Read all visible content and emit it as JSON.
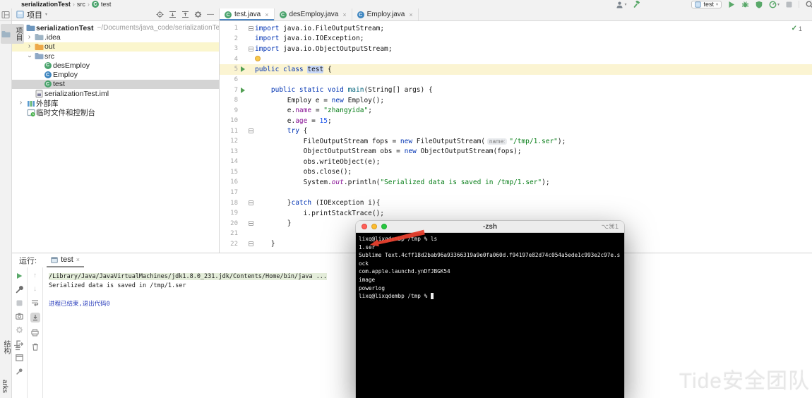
{
  "titlebar": {
    "breadcrumb": [
      "serializationTest",
      "src",
      "test"
    ],
    "run_config": "test"
  },
  "stripe": {
    "top_tab": "项目",
    "bottom_tab_1": "结构",
    "bottom_tab_2": "arks"
  },
  "project_panel": {
    "header_title": "项目",
    "tree": [
      {
        "lvl": 0,
        "chev": "v",
        "icon": "folder-root",
        "label": "serializationTest",
        "bold": true,
        "hint": "~/Documents/java_code/serializationTest"
      },
      {
        "lvl": 1,
        "chev": ">",
        "icon": "folder",
        "label": ".idea"
      },
      {
        "lvl": 1,
        "chev": ">",
        "icon": "folder-out",
        "label": "out",
        "row": "highlight"
      },
      {
        "lvl": 1,
        "chev": "v",
        "icon": "folder-src",
        "label": "src"
      },
      {
        "lvl": 2,
        "icon": "class-green",
        "label": "desEmploy"
      },
      {
        "lvl": 2,
        "icon": "class-blue",
        "label": "Employ"
      },
      {
        "lvl": 2,
        "icon": "class-green",
        "label": "test",
        "row": "selected"
      },
      {
        "lvl": 1,
        "icon": "file-iml",
        "label": "serializationTest.iml"
      },
      {
        "lvl": 0,
        "chev": ">",
        "icon": "libs",
        "label": "外部库"
      },
      {
        "lvl": 0,
        "icon": "scratch",
        "label": "临时文件和控制台"
      }
    ]
  },
  "editor": {
    "tabs": [
      {
        "label": "test.java",
        "icon": "class-green",
        "active": true
      },
      {
        "label": "desEmploy.java",
        "icon": "class-green",
        "active": false
      },
      {
        "label": "Employ.java",
        "icon": "class-blue",
        "active": false
      }
    ],
    "inspection_count": "1",
    "lines": [
      {
        "n": 1,
        "fold": true,
        "seg": [
          [
            "kw",
            "import "
          ],
          [
            "pl",
            "java.io.FileOutputStream;"
          ]
        ]
      },
      {
        "n": 2,
        "seg": [
          [
            "kw",
            "import "
          ],
          [
            "pl",
            "java.io.IOException;"
          ]
        ]
      },
      {
        "n": 3,
        "fold": true,
        "seg": [
          [
            "kw",
            "import "
          ],
          [
            "pl",
            "java.io.ObjectOutputStream;"
          ]
        ]
      },
      {
        "n": 4,
        "bulb": true,
        "seg": []
      },
      {
        "n": 5,
        "run": true,
        "hl": true,
        "seg": [
          [
            "kw",
            "public class "
          ],
          [
            "hlid",
            "test"
          ],
          [
            "pl",
            " {"
          ]
        ]
      },
      {
        "n": 6,
        "seg": []
      },
      {
        "n": 7,
        "run": true,
        "seg": [
          [
            "pl",
            "    "
          ],
          [
            "kw",
            "public static void "
          ],
          [
            "mth",
            "main"
          ],
          [
            "pl",
            "(String[] args) {"
          ]
        ]
      },
      {
        "n": 8,
        "seg": [
          [
            "pl",
            "        Employ e = "
          ],
          [
            "kw",
            "new"
          ],
          [
            "pl",
            " Employ();"
          ]
        ]
      },
      {
        "n": 9,
        "seg": [
          [
            "pl",
            "        e."
          ],
          [
            "fld",
            "name"
          ],
          [
            "pl",
            " = "
          ],
          [
            "str",
            "\"zhangyida\""
          ],
          [
            "pl",
            ";"
          ]
        ]
      },
      {
        "n": 10,
        "seg": [
          [
            "pl",
            "        e."
          ],
          [
            "fld",
            "age"
          ],
          [
            "pl",
            " = "
          ],
          [
            "num",
            "15"
          ],
          [
            "pl",
            ";"
          ]
        ]
      },
      {
        "n": 11,
        "fold": true,
        "seg": [
          [
            "pl",
            "        "
          ],
          [
            "kw",
            "try"
          ],
          [
            "pl",
            " {"
          ]
        ]
      },
      {
        "n": 12,
        "seg": [
          [
            "pl",
            "            FileOutputStream fops = "
          ],
          [
            "kw",
            "new"
          ],
          [
            "pl",
            " FileOutputStream("
          ],
          [
            "inlay",
            "name:"
          ],
          [
            "str",
            "\"/tmp/1.ser\""
          ],
          [
            "pl",
            ");"
          ]
        ]
      },
      {
        "n": 13,
        "seg": [
          [
            "pl",
            "            ObjectOutputStream obs = "
          ],
          [
            "kw",
            "new"
          ],
          [
            "pl",
            " ObjectOutputStream(fops);"
          ]
        ]
      },
      {
        "n": 14,
        "seg": [
          [
            "pl",
            "            obs.writeObject(e);"
          ]
        ]
      },
      {
        "n": 15,
        "seg": [
          [
            "pl",
            "            obs.close();"
          ]
        ]
      },
      {
        "n": 16,
        "seg": [
          [
            "pl",
            "            System."
          ],
          [
            "itf",
            "out"
          ],
          [
            "pl",
            ".println("
          ],
          [
            "str",
            "\"Serialized data is saved in /tmp/1.ser\""
          ],
          [
            "pl",
            ");"
          ]
        ]
      },
      {
        "n": 17,
        "seg": []
      },
      {
        "n": 18,
        "fold": true,
        "seg": [
          [
            "pl",
            "        }"
          ],
          [
            "kw",
            "catch"
          ],
          [
            "pl",
            " (IOException i){"
          ]
        ]
      },
      {
        "n": 19,
        "seg": [
          [
            "pl",
            "            i.printStackTrace();"
          ]
        ]
      },
      {
        "n": 20,
        "fold": true,
        "seg": [
          [
            "pl",
            "        }"
          ]
        ]
      },
      {
        "n": 21,
        "seg": []
      },
      {
        "n": 22,
        "fold": true,
        "seg": [
          [
            "pl",
            "    }"
          ]
        ]
      }
    ]
  },
  "run_panel": {
    "label": "运行:",
    "tab_label": "test",
    "console": [
      {
        "style": "cmd",
        "text": "/Library/Java/JavaVirtualMachines/jdk1.8.0_231.jdk/Contents/Home/bin/java ..."
      },
      {
        "style": "plain",
        "text": "Serialized data is saved in /tmp/1.ser"
      },
      {
        "style": "plain",
        "text": ""
      },
      {
        "style": "sys",
        "text": "进程已结束,退出代码0"
      }
    ]
  },
  "terminal": {
    "title": "-zsh",
    "shortcut": "⌥⌘1",
    "lines": [
      "lixq@lixqdembp /tmp % ls",
      "1.ser",
      "Sublime Text.4cff18d2bab96a93366319a9e0fa060d.f94197e82d74c054a5ede1c993e2c97e.sock",
      "com.apple.launchd.ynDfJBGK54",
      "image",
      "powerlog"
    ],
    "prompt": "lixq@lixqdembp /tmp % "
  },
  "watermark": "Tide安全团队",
  "colors": {
    "keyword": "#0033b3",
    "string": "#067d17",
    "number": "#1750eb",
    "field": "#871094",
    "method": "#00627a",
    "accent_green": "#59a869",
    "terminal_bg": "#000000",
    "arrow_red": "#e8402e"
  }
}
